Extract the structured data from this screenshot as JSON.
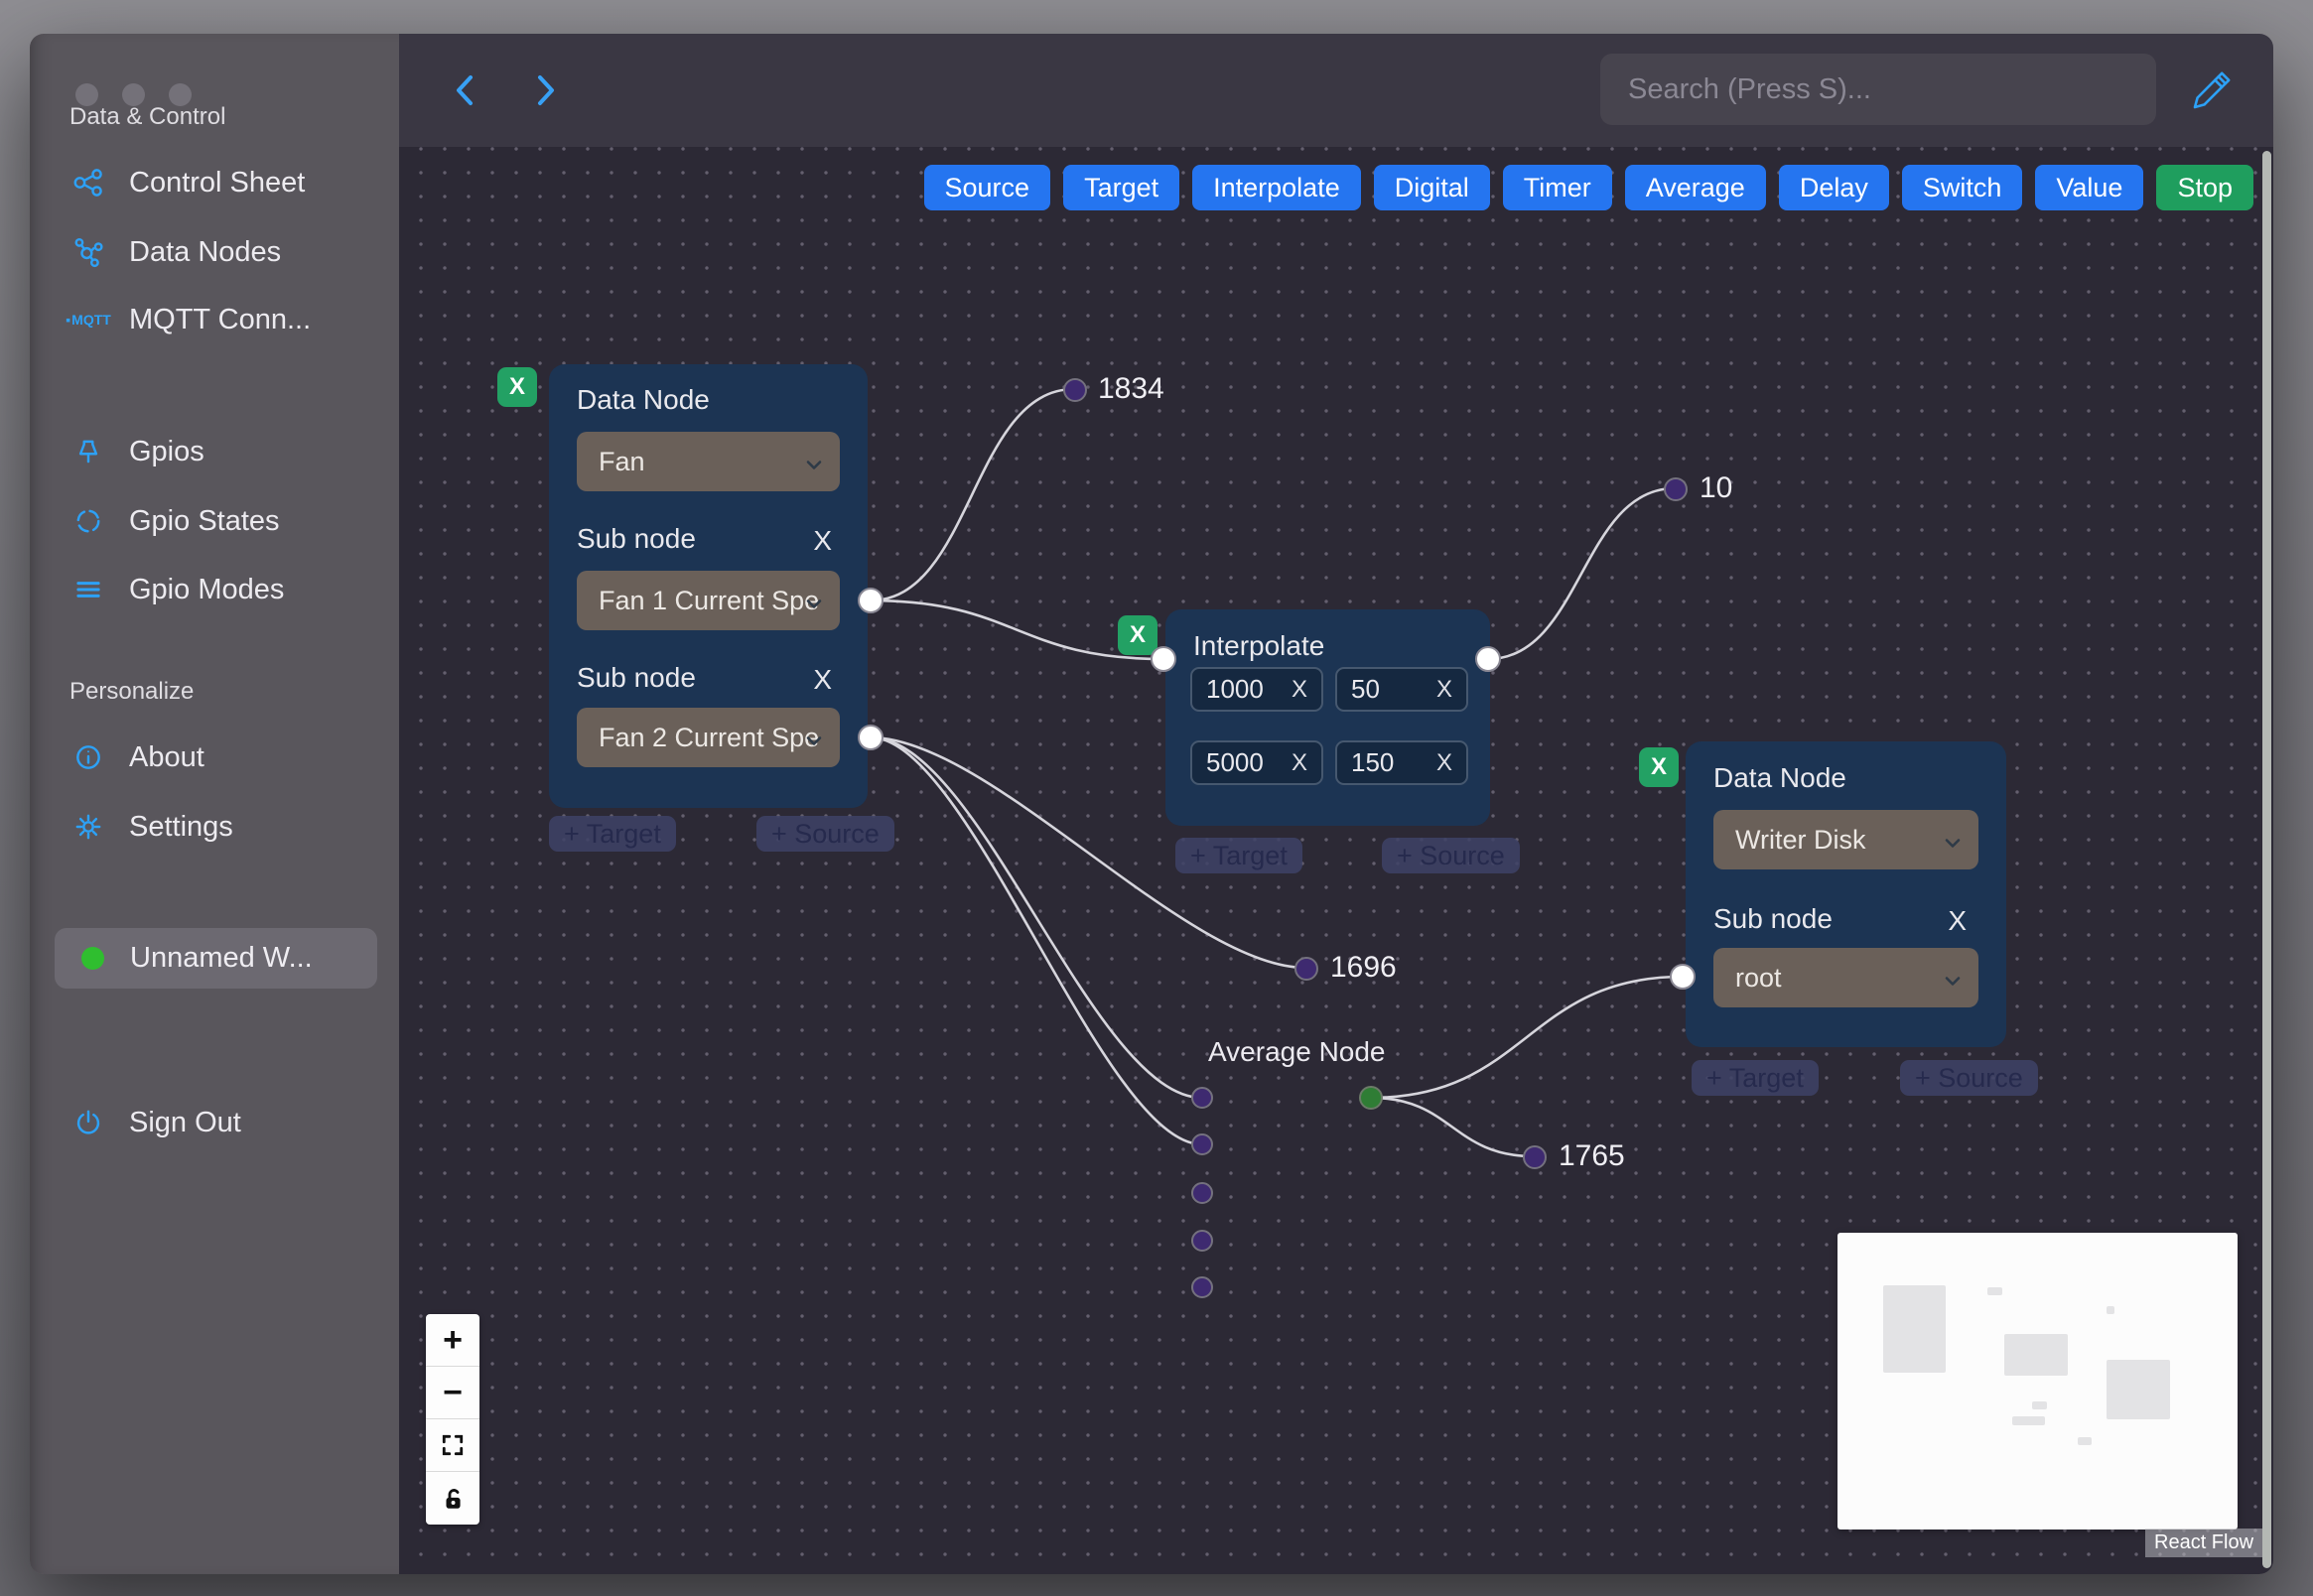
{
  "sidebar": {
    "sections": {
      "data_control": "Data & Control",
      "personalize": "Personalize"
    },
    "nav": [
      {
        "label": "Control Sheet"
      },
      {
        "label": "Data Nodes"
      },
      {
        "label": "MQTT Conn...",
        "icon_text": "MQTT"
      },
      {
        "label": "Gpios"
      },
      {
        "label": "Gpio States"
      },
      {
        "label": "Gpio Modes"
      },
      {
        "label": "About"
      },
      {
        "label": "Settings"
      }
    ],
    "workspace": {
      "label": "Unnamed W...",
      "status_color": "#2fbe2f"
    },
    "sign_out_label": "Sign Out"
  },
  "topbar": {
    "search_placeholder": "Search (Press S)..."
  },
  "toolbar": {
    "buttons": [
      {
        "label": "Source",
        "bg": "#2575f0"
      },
      {
        "label": "Target",
        "bg": "#2575f0"
      },
      {
        "label": "Interpolate",
        "bg": "#2575f0"
      },
      {
        "label": "Digital",
        "bg": "#2575f0"
      },
      {
        "label": "Timer",
        "bg": "#2575f0"
      },
      {
        "label": "Average",
        "bg": "#2575f0"
      },
      {
        "label": "Delay",
        "bg": "#2575f0"
      },
      {
        "label": "Switch",
        "bg": "#1f9e5e",
        "note": ""
      },
      {
        "label": "Value",
        "bg": "#2575f0"
      },
      {
        "label": "Stop",
        "bg": "#1f9e5e"
      }
    ]
  },
  "flow": {
    "fan_node": {
      "title": "Data Node",
      "type_value": "Fan",
      "sub1_label": "Sub node",
      "sub1_value": "Fan 1 Current Spe",
      "sub2_label": "Sub node",
      "sub2_value": "Fan 2 Current Spe",
      "remove": "X",
      "add_target": "+ Target",
      "add_source": "+ Source"
    },
    "interpolate_node": {
      "title": "Interpolate",
      "rows": [
        {
          "in": "1000",
          "out": "50"
        },
        {
          "in": "5000",
          "out": "150"
        }
      ],
      "remove": "X",
      "add_target": "+ Target",
      "add_source": "+ Source"
    },
    "writer_node": {
      "title": "Data Node",
      "type_value": "Writer Disk",
      "sub_label": "Sub node",
      "sub_value": "root",
      "remove": "X",
      "add_target": "+ Target",
      "add_source": "+ Source"
    },
    "average_node": {
      "title": "Average Node"
    },
    "edge_labels": [
      "1834",
      "10",
      "1696",
      "1765"
    ],
    "attribution": "React Flow"
  }
}
